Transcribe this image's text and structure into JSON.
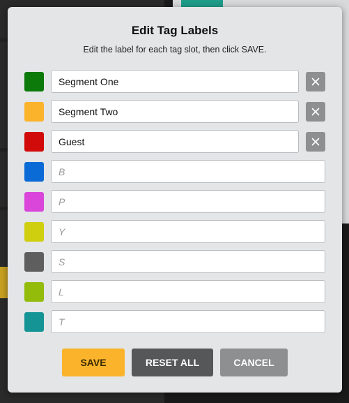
{
  "dialog": {
    "title": "Edit Tag Labels",
    "subtitle": "Edit the label for each tag slot, then click SAVE."
  },
  "tags": [
    {
      "color": "#0b7a0b",
      "value": "Segment One",
      "placeholder": "",
      "clearable": true
    },
    {
      "color": "#fbb32b",
      "value": "Segment Two",
      "placeholder": "",
      "clearable": true
    },
    {
      "color": "#d10a0a",
      "value": "Guest",
      "placeholder": "",
      "clearable": true
    },
    {
      "color": "#0b6bd6",
      "value": "",
      "placeholder": "B",
      "clearable": false
    },
    {
      "color": "#d946d9",
      "value": "",
      "placeholder": "P",
      "clearable": false
    },
    {
      "color": "#cfcf10",
      "value": "",
      "placeholder": "Y",
      "clearable": false
    },
    {
      "color": "#5e5e5e",
      "value": "",
      "placeholder": "S",
      "clearable": false
    },
    {
      "color": "#92bb0a",
      "value": "",
      "placeholder": "L",
      "clearable": false
    },
    {
      "color": "#149494",
      "value": "",
      "placeholder": "T",
      "clearable": false
    }
  ],
  "clear_icon": "close-icon",
  "buttons": {
    "save": "SAVE",
    "reset": "RESET ALL",
    "cancel": "CANCEL"
  }
}
